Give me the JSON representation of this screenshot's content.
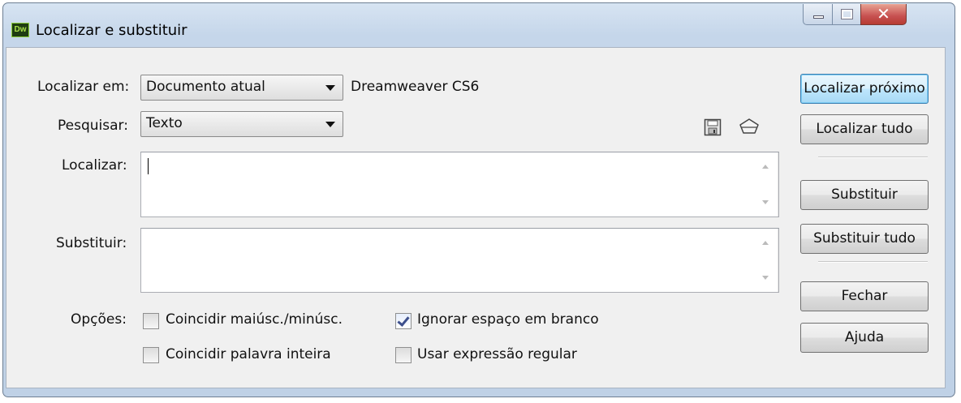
{
  "window": {
    "title": "Localizar e substituir",
    "app_icon_text": "Dw",
    "controls": {
      "minimize": "minimize",
      "maximize": "maximize",
      "close": "✕"
    }
  },
  "form": {
    "search_in": {
      "label": "Localizar em:",
      "value": "Documento atual",
      "context": "Dreamweaver CS6"
    },
    "search_type": {
      "label": "Pesquisar:",
      "value": "Texto"
    },
    "find": {
      "label": "Localizar:",
      "value": ""
    },
    "replace": {
      "label": "Substituir:",
      "value": ""
    },
    "options": {
      "label": "Opções:",
      "match_case": {
        "label": "Coincidir maiúsc./minúsc.",
        "checked": false
      },
      "ignore_whitespace": {
        "label": "Ignorar espaço em branco",
        "checked": true
      },
      "whole_word": {
        "label": "Coincidir palavra inteira",
        "checked": false
      },
      "regex": {
        "label": "Usar expressão regular",
        "checked": false
      }
    }
  },
  "buttons": {
    "find_next": "Localizar próximo",
    "find_all": "Localizar tudo",
    "replace": "Substituir",
    "replace_all": "Substituir tudo",
    "close": "Fechar",
    "help": "Ajuda"
  },
  "icons": {
    "save_query": "floppy-disk-icon",
    "load_query": "open-folder-icon"
  }
}
